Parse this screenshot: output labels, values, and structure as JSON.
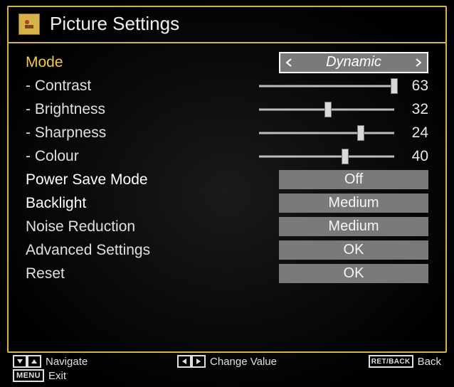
{
  "header": {
    "title": "Picture Settings"
  },
  "rows": {
    "mode": {
      "label": "Mode",
      "value": "Dynamic"
    },
    "contrast": {
      "label": "Contrast",
      "value": 63,
      "max": 63
    },
    "brightness": {
      "label": "Brightness",
      "value": 32,
      "max": 63
    },
    "sharpness": {
      "label": "Sharpness",
      "value": 24,
      "max": 32
    },
    "colour": {
      "label": "Colour",
      "value": 40,
      "max": 63
    },
    "power_save": {
      "label": "Power Save Mode",
      "value": "Off"
    },
    "backlight": {
      "label": "Backlight",
      "value": "Medium"
    },
    "noise": {
      "label": "Noise Reduction",
      "value": "Medium"
    },
    "advanced": {
      "label": "Advanced Settings",
      "value": "OK"
    },
    "reset": {
      "label": "Reset",
      "value": "OK"
    }
  },
  "footer": {
    "navigate": "Navigate",
    "change_value": "Change Value",
    "back": "Back",
    "back_key": "RET/BACK",
    "exit": "Exit",
    "menu_key": "MENU"
  },
  "colors": {
    "accent": "#d6b24a",
    "button_bg": "#7a7a7a"
  }
}
